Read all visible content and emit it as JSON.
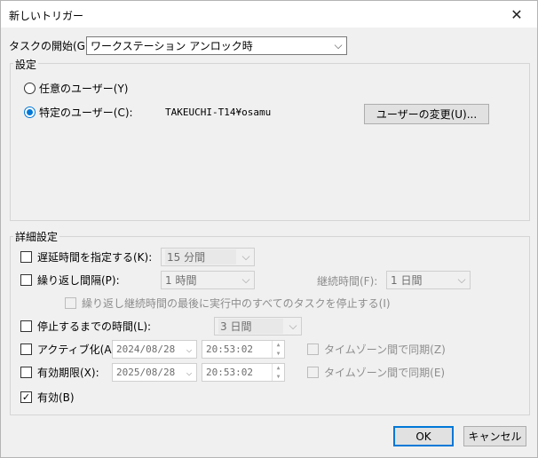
{
  "window": {
    "title": "新しいトリガー"
  },
  "begin_task": {
    "label": "タスクの開始(G):",
    "value": "ワークステーション アンロック時"
  },
  "settings": {
    "label": "設定",
    "any_user_label": "任意のユーザー(Y)",
    "specific_user_label": "特定のユーザー(C):",
    "user_name": "TAKEUCHI-T14¥osamu",
    "change_user_button": "ユーザーの変更(U)..."
  },
  "advanced": {
    "label": "詳細設定",
    "delay_label": "遅延時間を指定する(K):",
    "delay_value": "15 分間",
    "repeat_label": "繰り返し間隔(P):",
    "repeat_value": "1 時間",
    "duration_label": "継続時間(F):",
    "duration_value": "1 日間",
    "stop_running_label": "繰り返し継続時間の最後に実行中のすべてのタスクを停止する(I)",
    "stop_after_label": "停止するまでの時間(L):",
    "stop_after_value": "3 日間",
    "activate_label": "アクティブ化(A):",
    "activate_date": "2024/08/28",
    "activate_time": "20:53:02",
    "sync_tz_label_z": "タイムゾーン間で同期(Z)",
    "expire_label": "有効期限(X):",
    "expire_date": "2025/08/28",
    "expire_time": "20:53:02",
    "sync_tz_label_e": "タイムゾーン間で同期(E)",
    "enabled_label": "有効(B)",
    "enabled_check": "✓"
  },
  "buttons": {
    "ok": "OK",
    "cancel": "キャンセル"
  },
  "icons": {
    "close": "✕",
    "chevron": "⌵",
    "spin_up": "▲",
    "spin_down": "▼"
  }
}
